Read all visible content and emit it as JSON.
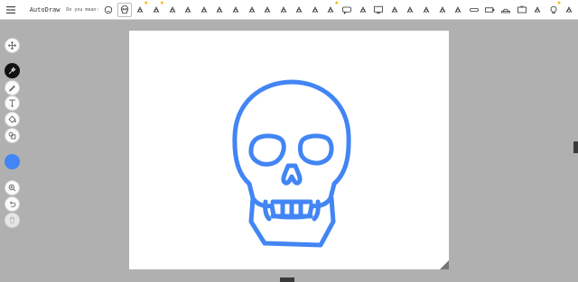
{
  "app": {
    "title": "AutoDraw"
  },
  "suggestions": {
    "label": "Do you mean:",
    "items": [
      {
        "icon": "baby-face-icon"
      },
      {
        "icon": "skull-icon",
        "selected": true
      },
      {
        "icon": "mouse-face-icon",
        "starred": true
      },
      {
        "icon": "cat-face-icon",
        "starred": true
      },
      {
        "icon": "owl-face-icon"
      },
      {
        "icon": "tiger-face-icon"
      },
      {
        "icon": "bear-face-icon"
      },
      {
        "icon": "bunny-face-icon"
      },
      {
        "icon": "piano-icon"
      },
      {
        "icon": "film-camera-icon"
      },
      {
        "icon": "bird-icon"
      },
      {
        "icon": "lamp-icon"
      },
      {
        "icon": "spider-icon"
      },
      {
        "icon": "moose-icon"
      },
      {
        "icon": "sparkle-icon",
        "starred": true
      },
      {
        "icon": "speech-bubble-icon"
      },
      {
        "icon": "cart-icon"
      },
      {
        "icon": "monitor-icon"
      },
      {
        "icon": "deer-icon"
      },
      {
        "icon": "spaceship-icon"
      },
      {
        "icon": "tent-icon"
      },
      {
        "icon": "eiffel-tower-icon"
      },
      {
        "icon": "fish-icon"
      },
      {
        "icon": "pill-icon"
      },
      {
        "icon": "battery-icon"
      },
      {
        "icon": "car-icon"
      },
      {
        "icon": "television-icon"
      },
      {
        "icon": "cargo-truck-icon"
      },
      {
        "icon": "lightbulb-icon",
        "starred": true
      },
      {
        "icon": "candle-icon"
      }
    ]
  },
  "tools": [
    {
      "name": "select-tool",
      "icon": "move-icon"
    },
    {
      "name": "autodraw-tool",
      "icon": "autodraw-sparkle-icon",
      "active": true
    },
    {
      "name": "draw-tool",
      "icon": "pencil-icon"
    },
    {
      "name": "type-tool",
      "icon": "text-icon"
    },
    {
      "name": "fill-tool",
      "icon": "paint-bucket-icon"
    },
    {
      "name": "shape-tool",
      "icon": "shapes-icon"
    },
    {
      "name": "color-tool",
      "icon": "color-swatch-icon",
      "color": "#4285f4"
    },
    {
      "name": "zoom-tool",
      "icon": "zoom-icon"
    },
    {
      "name": "undo-tool",
      "icon": "undo-icon"
    },
    {
      "name": "delete-tool",
      "icon": "trash-icon",
      "disabled": true
    }
  ],
  "colors": {
    "stroke": "#4285f4",
    "canvas": "#ffffff",
    "background": "#b0b0b0"
  }
}
